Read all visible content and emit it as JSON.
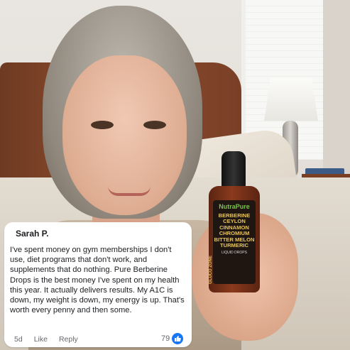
{
  "comment": {
    "author": "Sarah P.",
    "text": "I've spent money on gym memberships I don't use, diet programs that don't work, and supplements that do nothing. Pure Berberine Drops is the best money I've spent on my health this year. It actually delivers results. My A1C is down, my weight is down, my energy is up. That's worth every penny and then some.",
    "time": "5d",
    "like_label": "Like",
    "reply_label": "Reply",
    "like_count": "79",
    "like_icon": "thumbs-up-icon",
    "accent": "#1877f2"
  },
  "product": {
    "brand": "NutraPure",
    "side_text": "GLUCO ZONE",
    "ingredients": [
      "BERBERINE",
      "CEYLON CINNAMON",
      "CHROMIUM",
      "BITTER MELON",
      "TURMERIC"
    ],
    "subtitle": "LIQUID DROPS"
  }
}
